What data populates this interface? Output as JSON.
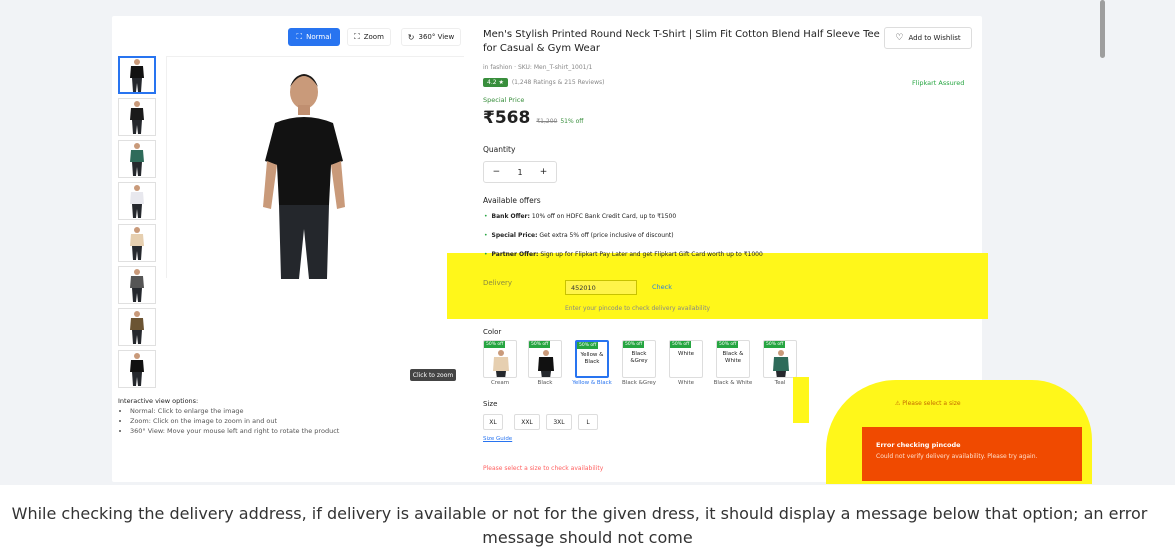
{
  "gallery": {
    "view_buttons": {
      "normal": "Normal",
      "zoom": "Zoom",
      "view360": "360° View"
    },
    "click_to_zoom": "Click to zoom",
    "thumbnail_colors": [
      "#111111",
      "#1a1a1a",
      "#2e6b5a",
      "#e8e8ee",
      "#e6cfb0",
      "#555555",
      "#6b5433",
      "#111111"
    ],
    "view_options_title": "Interactive view options:",
    "view_options": [
      "Normal: Click to enlarge the image",
      "Zoom: Click on the image to zoom in and out",
      "360° View: Move your mouse left and right to rotate the product"
    ]
  },
  "product": {
    "title": "Men's Stylish Printed Round Neck T-Shirt | Slim Fit Cotton Blend Half Sleeve Tee for Casual & Gym Wear",
    "wishlist_label": "Add to Wishlist",
    "meta": "in fashion · SKU: Men_T-shirt_1001/1",
    "rating": "4.2 ★",
    "rating_summary": "(1,248 Ratings & 215 Reviews)",
    "assured": "Flipkart Assured",
    "special_price_label": "Special Price",
    "price": "₹568",
    "mrp": "₹1,200",
    "discount": "51% off",
    "quantity_label": "Quantity",
    "quantity": "1",
    "offers_title": "Available offers",
    "offers": [
      {
        "title": "Bank Offer:",
        "text": "10% off on HDFC Bank Credit Card, up to ₹1500"
      },
      {
        "title": "Special Price:",
        "text": "Get extra 5% off (price inclusive of discount)"
      },
      {
        "title": "Partner Offer:",
        "text": "Sign up for Flipkart Pay Later and get Flipkart Gift Card worth up to ₹1000"
      }
    ]
  },
  "delivery": {
    "label": "Delivery",
    "pincode": "452010",
    "check": "Check",
    "help": "Enter your pincode to check delivery availability"
  },
  "colors": {
    "label": "Color",
    "swatches": [
      {
        "name": "Cream",
        "offer": "50% off",
        "tile": "",
        "color": "#e6cfb0",
        "selected": false
      },
      {
        "name": "Black",
        "offer": "50% off",
        "tile": "",
        "color": "#111111",
        "selected": false
      },
      {
        "name": "Yellow & Black",
        "offer": "50% off",
        "tile": "Yellow & Black",
        "color": "",
        "selected": true
      },
      {
        "name": "Black &Grey",
        "offer": "50% off",
        "tile": "Black &Grey",
        "color": "",
        "selected": false
      },
      {
        "name": "White",
        "offer": "50% off",
        "tile": "White",
        "color": "",
        "selected": false
      },
      {
        "name": "Black & White",
        "offer": "50% off",
        "tile": "Black & White",
        "color": "",
        "selected": false
      },
      {
        "name": "Teal",
        "offer": "50% off",
        "tile": "",
        "color": "#2e6b5a",
        "selected": false
      }
    ]
  },
  "sizes": {
    "label": "Size",
    "options": [
      "XL",
      "XXL",
      "3XL",
      "L"
    ],
    "size_chart": "Size Guide",
    "warning": "Please select a size to check availability",
    "select_prompt": "⚠ Please select a size"
  },
  "toast": {
    "title": "Error checking pincode",
    "message": "Could not verify delivery availability. Please try again."
  },
  "caption": {
    "line1": "While checking the delivery address, if delivery is available or not for the given dress, it should display a message below that option; an error",
    "line2": "message should not come"
  },
  "colors_theme": {
    "primary": "#2874f0",
    "green": "#388e3c",
    "highlight": "#fff71a",
    "error": "#f04a00"
  }
}
